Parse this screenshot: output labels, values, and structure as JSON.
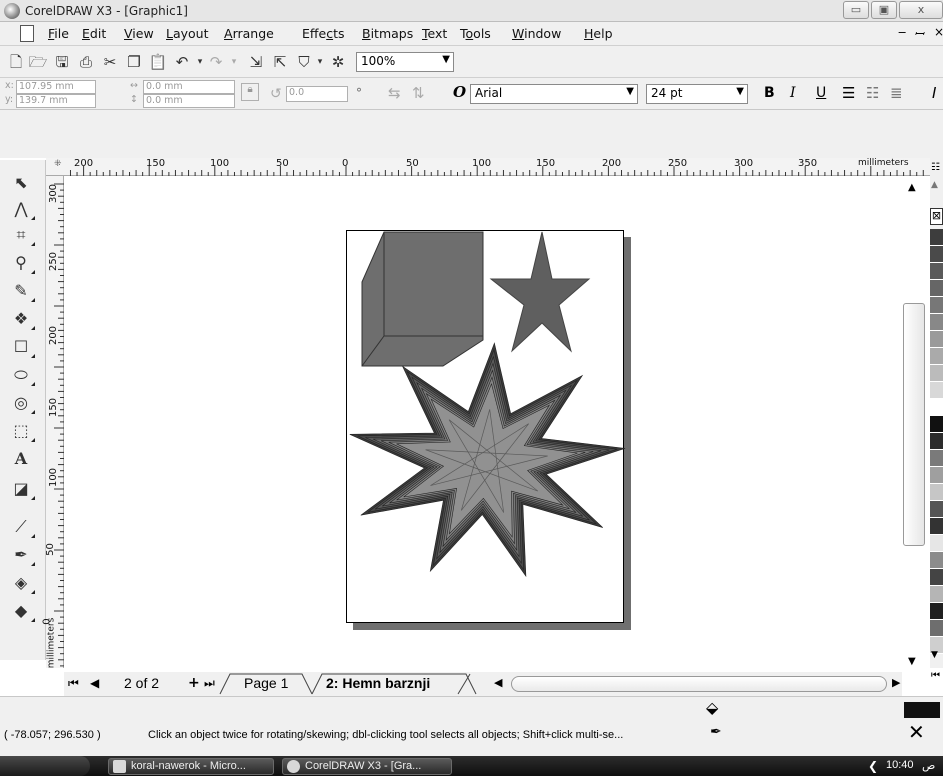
{
  "window": {
    "title": "CorelDRAW X3 - [Graphic1]"
  },
  "menu": [
    "File",
    "Edit",
    "View",
    "Layout",
    "Arrange",
    "Effects",
    "Bitmaps",
    "Text",
    "Tools",
    "Window",
    "Help"
  ],
  "menu_mnemonic_index": [
    0,
    0,
    0,
    0,
    0,
    4,
    0,
    0,
    1,
    0,
    0
  ],
  "toolbar": {
    "zoom": "100%"
  },
  "propbar": {
    "x": "107.95 mm",
    "y": "139.7 mm",
    "w": "0.0 mm",
    "h": "0.0 mm",
    "angle": "0.0",
    "degree_symbol": "°",
    "font_icon": "O",
    "font": "Arial",
    "size": "24 pt",
    "bold": "B",
    "italic": "I",
    "underline": "U"
  },
  "ruler": {
    "h_labels": [
      "200",
      "150",
      "100",
      "50",
      "0",
      "50",
      "100",
      "150",
      "200",
      "250",
      "300",
      "350"
    ],
    "h_unit": "millimeters",
    "v_labels": [
      "300",
      "250",
      "200",
      "150",
      "100",
      "50",
      "0"
    ],
    "v_unit": "millimeters"
  },
  "pages": {
    "counter": "2 of 2",
    "tab1": "Page 1",
    "tab2": "2: Hemn barznji"
  },
  "status": {
    "coords": "( -78.057; 296.530 )",
    "message": "Click an object twice for rotating/skewing; dbl-clicking tool selects all objects; Shift+click multi-se..."
  },
  "taskbar": {
    "items": [
      "koral-nawerok - Micro...",
      "CorelDRAW X3 - [Gra..."
    ],
    "clock": "10:40",
    "clock_suffix": "ص"
  },
  "palette_colors": [
    "#3d3d3d",
    "#4a4a4a",
    "#5a5a5a",
    "#666",
    "#777",
    "#888",
    "#9a9a9a",
    "#aaa",
    "#bbb",
    "#d8d8d8",
    "#fff",
    "#111",
    "#2c2c2c",
    "#7a7a7a",
    "#9f9f9f",
    "#c6c6c6",
    "#555",
    "#333",
    "#e6e6e6",
    "#8c8c8c",
    "#444",
    "#b5b5b5",
    "#202020",
    "#6e6e6e",
    "#cfcfcf"
  ]
}
